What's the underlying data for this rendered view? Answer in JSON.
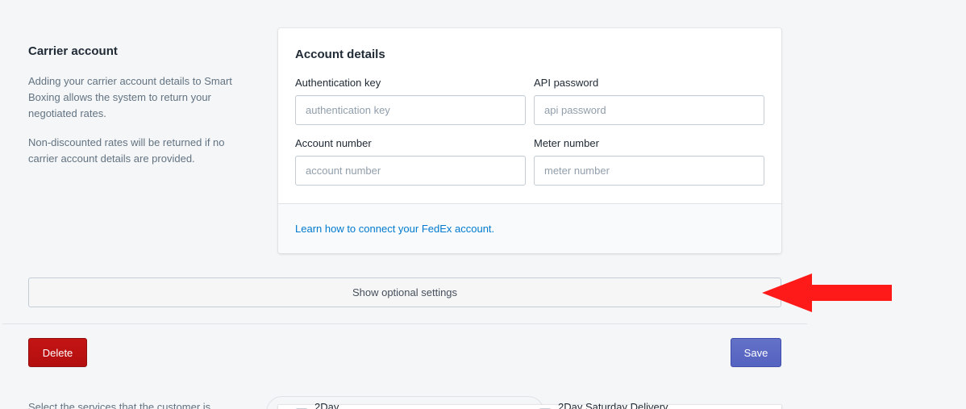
{
  "section": {
    "title": "Carrier account",
    "description_1": "Adding your carrier account details to Smart Boxing allows the system to return your negotiated rates.",
    "description_2": "Non-discounted rates will be returned if no carrier account details are provided."
  },
  "card": {
    "title": "Account details",
    "fields": {
      "auth_key": {
        "label": "Authentication key",
        "placeholder": "authentication key"
      },
      "api_password": {
        "label": "API password",
        "placeholder": "api password"
      },
      "account_number": {
        "label": "Account number",
        "placeholder": "account number"
      },
      "meter_number": {
        "label": "Meter number",
        "placeholder": "meter number"
      }
    },
    "help_link": "Learn how to connect your FedEx account."
  },
  "optional_settings_label": "Show optional settings",
  "actions": {
    "delete_label": "Delete",
    "save_label": "Save"
  },
  "below_fold": {
    "services_hint": "Select the services that the customer is",
    "option_1": "2Day",
    "option_2": "2Day Saturday Delivery"
  },
  "colors": {
    "link": "#007ace",
    "delete": "#bf0711",
    "save": "#5c6ac4",
    "arrow": "#ff1a1a"
  }
}
